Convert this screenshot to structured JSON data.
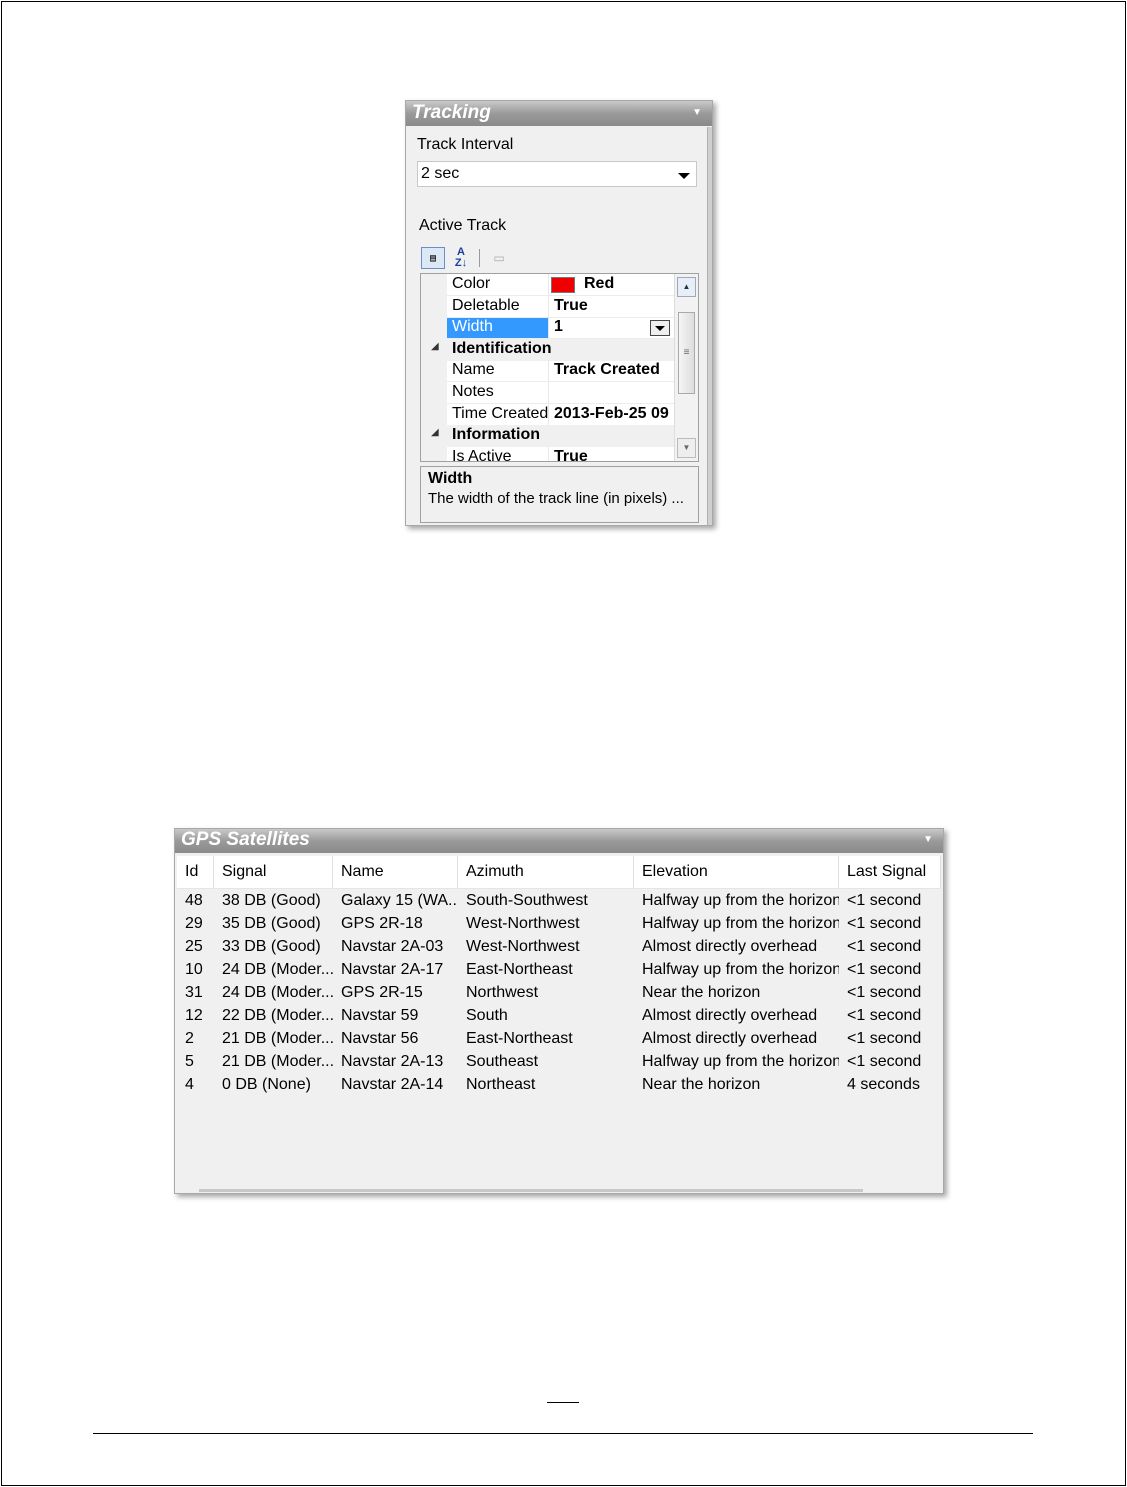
{
  "tracking": {
    "title": "Tracking",
    "interval_label": "Track Interval",
    "interval_value": "2 sec",
    "active_track_label": "Active Track",
    "properties": [
      {
        "name": "Color",
        "value": "Red",
        "swatch": "#ee0000"
      },
      {
        "name": "Deletable",
        "value": "True"
      },
      {
        "name": "Width",
        "value": "1",
        "selected": true
      },
      {
        "category": "Identification"
      },
      {
        "name": "Name",
        "value": "Track Created"
      },
      {
        "name": "Notes",
        "value": ""
      },
      {
        "name": "Time Created",
        "value": "2013-Feb-25 09"
      },
      {
        "category": "Information"
      },
      {
        "name": "Is Active",
        "value": "True"
      }
    ],
    "help_title": "Width",
    "help_text": "The width of the track line (in pixels) ..."
  },
  "gps": {
    "title": "GPS Satellites",
    "columns": [
      "Id",
      "Signal",
      "Name",
      "Azimuth",
      "Elevation",
      "Last Signal"
    ],
    "rows": [
      [
        "48",
        "38 DB (Good)",
        "Galaxy 15 (WA...",
        "South-Southwest",
        "Halfway up from the horizon",
        "<1 second"
      ],
      [
        "29",
        "35 DB (Good)",
        "GPS 2R-18",
        "West-Northwest",
        "Halfway up from the horizon",
        "<1 second"
      ],
      [
        "25",
        "33 DB (Good)",
        "Navstar 2A-03",
        "West-Northwest",
        "Almost directly overhead",
        "<1 second"
      ],
      [
        "10",
        "24 DB (Moder...",
        "Navstar 2A-17",
        "East-Northeast",
        "Halfway up from the horizon",
        "<1 second"
      ],
      [
        "31",
        "24 DB (Moder...",
        "GPS 2R-15",
        "Northwest",
        "Near the horizon",
        "<1 second"
      ],
      [
        "12",
        "22 DB (Moder...",
        "Navstar 59",
        "South",
        "Almost directly overhead",
        "<1 second"
      ],
      [
        "2",
        "21 DB (Moder...",
        "Navstar 56",
        "East-Northeast",
        "Almost directly overhead",
        "<1 second"
      ],
      [
        "5",
        "21 DB (Moder...",
        "Navstar 2A-13",
        "Southeast",
        "Halfway up from the horizon",
        "<1 second"
      ],
      [
        "4",
        "0 DB (None)",
        "Navstar 2A-14",
        "Northeast",
        "Near the horizon",
        "4 seconds"
      ]
    ]
  },
  "colors": {
    "selection": "#3399ff",
    "swatch_red": "#ee0000"
  }
}
